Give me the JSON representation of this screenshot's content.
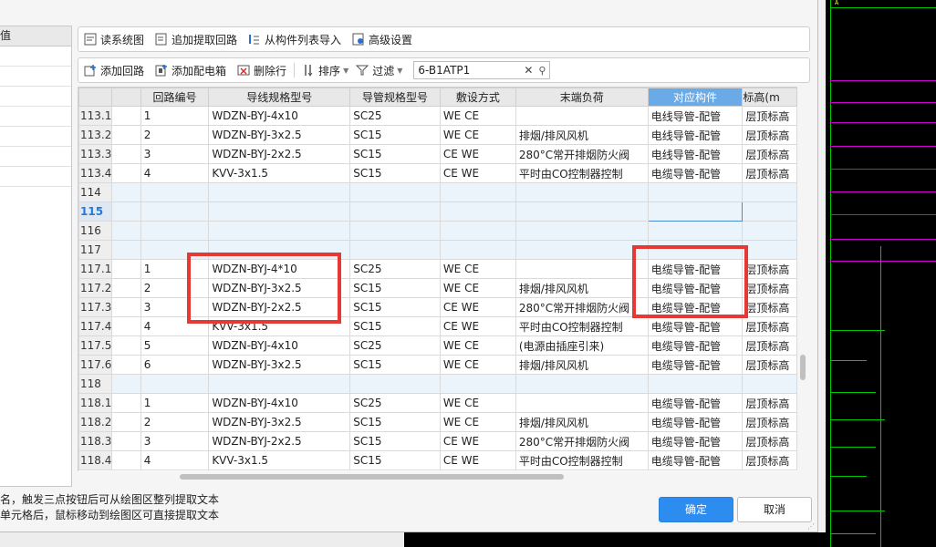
{
  "left_panel": {
    "header": "值"
  },
  "toolbar1": {
    "read_system": "读系统图",
    "append_extract": "追加提取回路",
    "import_from_list": "从构件列表导入",
    "advanced": "高级设置"
  },
  "toolbar2": {
    "add_loop": "添加回路",
    "add_box": "添加配电箱",
    "delete_row": "删除行",
    "sort": "排序",
    "filter": "过滤",
    "search_value": "6-B1ATP1"
  },
  "columns": [
    "回路编号",
    "导线规格型号",
    "导管规格型号",
    "敷设方式",
    "末端负荷",
    "对应构件",
    "标高(m"
  ],
  "rows": [
    {
      "rn": "113.1",
      "loop": "1",
      "wire": "WDZN-BYJ-4x10",
      "conduit": "SC25",
      "lay": "WE CE",
      "load": "",
      "comp": "电线导管-配管",
      "elev": "层顶标高"
    },
    {
      "rn": "113.2",
      "loop": "2",
      "wire": "WDZN-BYJ-3x2.5",
      "conduit": "SC15",
      "lay": "WE CE",
      "load": "排烟/排风风机",
      "comp": "电线导管-配管",
      "elev": "层顶标高"
    },
    {
      "rn": "113.3",
      "loop": "3",
      "wire": "WDZN-BYJ-2x2.5",
      "conduit": "SC15",
      "lay": "CE WE",
      "load": "280°C常开排烟防火阀",
      "comp": "电线导管-配管",
      "elev": "层顶标高"
    },
    {
      "rn": "113.4",
      "loop": "4",
      "wire": "KVV-3x1.5",
      "conduit": "SC15",
      "lay": "CE WE",
      "load": "平时由CO控制器控制",
      "comp": "电缆导管-配管",
      "elev": "层顶标高"
    },
    {
      "rn": "114",
      "group": true
    },
    {
      "rn": "115",
      "group": true,
      "selected": true
    },
    {
      "rn": "116",
      "group": true
    },
    {
      "rn": "117",
      "group": true
    },
    {
      "rn": "117.1",
      "loop": "1",
      "wire": "WDZN-BYJ-4*10",
      "conduit": "SC25",
      "lay": "WE CE",
      "load": "",
      "comp": "电缆导管-配管",
      "elev": "层顶标高"
    },
    {
      "rn": "117.2",
      "loop": "2",
      "wire": "WDZN-BYJ-3x2.5",
      "conduit": "SC15",
      "lay": "WE CE",
      "load": "排烟/排风风机",
      "comp": "电缆导管-配管",
      "elev": "层顶标高"
    },
    {
      "rn": "117.3",
      "loop": "3",
      "wire": "WDZN-BYJ-2x2.5",
      "conduit": "SC15",
      "lay": "CE WE",
      "load": "280°C常开排烟防火阀",
      "comp": "电缆导管-配管",
      "elev": "层顶标高"
    },
    {
      "rn": "117.4",
      "loop": "4",
      "wire": "KVV-3x1.5",
      "conduit": "SC15",
      "lay": "CE WE",
      "load": "平时由CO控制器控制",
      "comp": "电缆导管-配管",
      "elev": "层顶标高"
    },
    {
      "rn": "117.5",
      "loop": "5",
      "wire": "WDZN-BYJ-4x10",
      "conduit": "SC25",
      "lay": "WE CE",
      "load": "(电源由插座引来)",
      "comp": "电缆导管-配管",
      "elev": "层顶标高"
    },
    {
      "rn": "117.6",
      "loop": "6",
      "wire": "WDZN-BYJ-3x2.5",
      "conduit": "SC15",
      "lay": "WE CE",
      "load": "排烟/排风风机",
      "comp": "电缆导管-配管",
      "elev": "层顶标高"
    },
    {
      "rn": "118",
      "group": true
    },
    {
      "rn": "118.1",
      "loop": "1",
      "wire": "WDZN-BYJ-4x10",
      "conduit": "SC25",
      "lay": "WE CE",
      "load": "",
      "comp": "电缆导管-配管",
      "elev": "层顶标高"
    },
    {
      "rn": "118.2",
      "loop": "2",
      "wire": "WDZN-BYJ-3x2.5",
      "conduit": "SC15",
      "lay": "WE CE",
      "load": "排烟/排风风机",
      "comp": "电缆导管-配管",
      "elev": "层顶标高"
    },
    {
      "rn": "118.3",
      "loop": "3",
      "wire": "WDZN-BYJ-2x2.5",
      "conduit": "SC15",
      "lay": "CE WE",
      "load": "280°C常开排烟防火阀",
      "comp": "电缆导管-配管",
      "elev": "层顶标高"
    },
    {
      "rn": "118.4",
      "loop": "4",
      "wire": "KVV-3x1.5",
      "conduit": "SC15",
      "lay": "CE WE",
      "load": "平时由CO控制器控制",
      "comp": "电缆导管-配管",
      "elev": "层顶标高"
    }
  ],
  "hints": {
    "line1": "名，触发三点按钮后可从绘图区整列提取文本",
    "line2": "单元格后，鼠标移动到绘图区可直接提取文本"
  },
  "buttons": {
    "ok": "确定",
    "cancel": "取消"
  },
  "colors": {
    "accent": "#2d8cf0",
    "highlight_box": "#e53935",
    "active_header": "#6aaae6"
  }
}
